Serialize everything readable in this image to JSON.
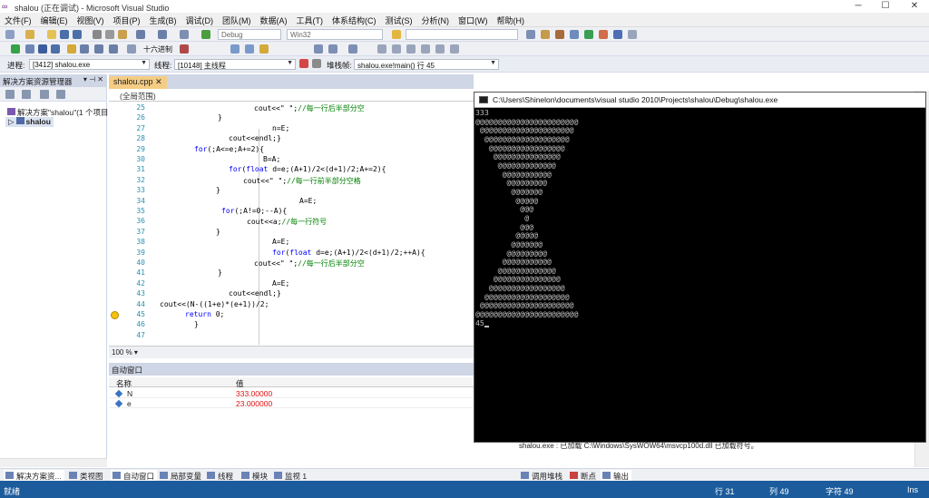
{
  "window": {
    "title": "shalou (正在调试) - Microsoft Visual Studio"
  },
  "menu": [
    "文件(F)",
    "编辑(E)",
    "视图(V)",
    "项目(P)",
    "生成(B)",
    "调试(D)",
    "团队(M)",
    "数据(A)",
    "工具(T)",
    "体系结构(C)",
    "测试(S)",
    "分析(N)",
    "窗口(W)",
    "帮助(H)"
  ],
  "toolbar": {
    "hex_label": "十六进制",
    "config": "Debug",
    "platform": "Win32",
    "process_label": "进程:",
    "process_value": "[3412] shalou.exe",
    "thread_label": "线程:",
    "thread_value": "[10148] 主线程",
    "stack_label": "堆栈帧:",
    "stack_value": "shalou.exe!main() 行 45"
  },
  "solution_explorer": {
    "title": "解决方案资源管理器",
    "solution": "解决方案\"shalou\"(1 个项目",
    "project": "shalou"
  },
  "editor": {
    "tab": "shalou.cpp",
    "scope": "(全局范围)",
    "zoom": "100 %",
    "lines": [
      {
        "n": "25",
        "indent": 110,
        "parts": [
          [
            "t",
            "cout<<\" \";"
          ],
          [
            "c",
            "//每一行后半部分空"
          ]
        ]
      },
      {
        "n": "26",
        "indent": 70,
        "parts": [
          [
            "t",
            "}"
          ]
        ]
      },
      {
        "n": "27",
        "indent": 130,
        "parts": [
          [
            "t",
            "n=E;"
          ]
        ]
      },
      {
        "n": "28",
        "indent": 82,
        "parts": [
          [
            "t",
            "cout<<endl;}"
          ]
        ]
      },
      {
        "n": "29",
        "indent": 44,
        "parts": [
          [
            "k",
            "for"
          ],
          [
            "t",
            "(;A<=e;A+=2){"
          ]
        ]
      },
      {
        "n": "30",
        "indent": 120,
        "parts": [
          [
            "t",
            "B=A;"
          ]
        ]
      },
      {
        "n": "31",
        "indent": 82,
        "parts": [
          [
            "k",
            "for"
          ],
          [
            "t",
            "("
          ],
          [
            "k",
            "float"
          ],
          [
            "t",
            " d=e;(A+1)/2<(d+1)/2;A+=2){"
          ]
        ]
      },
      {
        "n": "32",
        "indent": 98,
        "parts": [
          [
            "t",
            "cout<<\" \";"
          ],
          [
            "c",
            "//每一行前半部分空格"
          ]
        ]
      },
      {
        "n": "33",
        "indent": 68,
        "parts": [
          [
            "t",
            "}"
          ]
        ]
      },
      {
        "n": "34",
        "indent": 160,
        "parts": [
          [
            "t",
            "A=E;"
          ]
        ]
      },
      {
        "n": "35",
        "indent": 74,
        "parts": [
          [
            "k",
            "for"
          ],
          [
            "t",
            "(;A!=0;--A){"
          ]
        ]
      },
      {
        "n": "36",
        "indent": 102,
        "parts": [
          [
            "t",
            "cout<<a;"
          ],
          [
            "c",
            "//每一行符号"
          ]
        ]
      },
      {
        "n": "37",
        "indent": 68,
        "parts": [
          [
            "t",
            "}"
          ]
        ]
      },
      {
        "n": "38",
        "indent": 130,
        "parts": [
          [
            "t",
            "A=E;"
          ]
        ]
      },
      {
        "n": "39",
        "indent": 130,
        "parts": [
          [
            "k",
            "for"
          ],
          [
            "t",
            "("
          ],
          [
            "k",
            "float"
          ],
          [
            "t",
            " d=e;(A+1)/2<(d+1)/2;++A){"
          ]
        ]
      },
      {
        "n": "40",
        "indent": 110,
        "parts": [
          [
            "t",
            "cout<<\" \";"
          ],
          [
            "c",
            "//每一行后半部分空"
          ]
        ]
      },
      {
        "n": "41",
        "indent": 70,
        "parts": [
          [
            "t",
            "}"
          ]
        ]
      },
      {
        "n": "42",
        "indent": 130,
        "parts": [
          [
            "t",
            "A=E;"
          ]
        ]
      },
      {
        "n": "43",
        "indent": 82,
        "parts": [
          [
            "t",
            "cout<<endl;}"
          ]
        ]
      },
      {
        "n": "44",
        "indent": 6,
        "parts": [
          [
            "t",
            "cout<<(N-((1+e)*(e+1))/2;"
          ]
        ]
      },
      {
        "n": "45",
        "indent": 34,
        "parts": [
          [
            "k",
            "return"
          ],
          [
            "t",
            " 0;"
          ]
        ]
      },
      {
        "n": "46",
        "indent": 44,
        "parts": [
          [
            "t",
            "}"
          ]
        ]
      },
      {
        "n": "47",
        "indent": 0,
        "parts": []
      }
    ]
  },
  "auto_window": {
    "title": "自动窗口",
    "col_name": "名称",
    "col_value": "值",
    "rows": [
      {
        "name": "N",
        "value": "333.00000"
      },
      {
        "name": "e",
        "value": "23.000000"
      }
    ]
  },
  "bottom_tabs_left": [
    "解决方案资...",
    "类视图"
  ],
  "bottom_tabs_mid": [
    "自动窗口",
    "局部变量",
    "线程",
    "模块",
    "监视 1"
  ],
  "bottom_tabs_right": [
    "调用堆栈",
    "断点",
    "输出"
  ],
  "output_text": "shalou.exe : 已加载 C:\\Windows\\SysWOW64\\msvcp100d.dll  已加载符号。",
  "console": {
    "title": "C:\\Users\\Shinelon\\documents\\visual studio 2010\\Projects\\shalou\\Debug\\shalou.exe",
    "lines": [
      "333",
      "@@@@@@@@@@@@@@@@@@@@@@@",
      " @@@@@@@@@@@@@@@@@@@@@",
      "  @@@@@@@@@@@@@@@@@@@",
      "   @@@@@@@@@@@@@@@@@",
      "    @@@@@@@@@@@@@@@",
      "     @@@@@@@@@@@@@",
      "      @@@@@@@@@@@",
      "       @@@@@@@@@",
      "        @@@@@@@",
      "         @@@@@",
      "          @@@",
      "           @",
      "          @@@",
      "         @@@@@",
      "        @@@@@@@",
      "       @@@@@@@@@",
      "      @@@@@@@@@@@",
      "     @@@@@@@@@@@@@",
      "    @@@@@@@@@@@@@@@",
      "   @@@@@@@@@@@@@@@@@",
      "  @@@@@@@@@@@@@@@@@@@",
      " @@@@@@@@@@@@@@@@@@@@@",
      "@@@@@@@@@@@@@@@@@@@@@@@",
      "45"
    ]
  },
  "status": {
    "ready": "就绪",
    "line": "行 31",
    "col": "列 49",
    "char": "字符 49",
    "ins": "Ins"
  }
}
